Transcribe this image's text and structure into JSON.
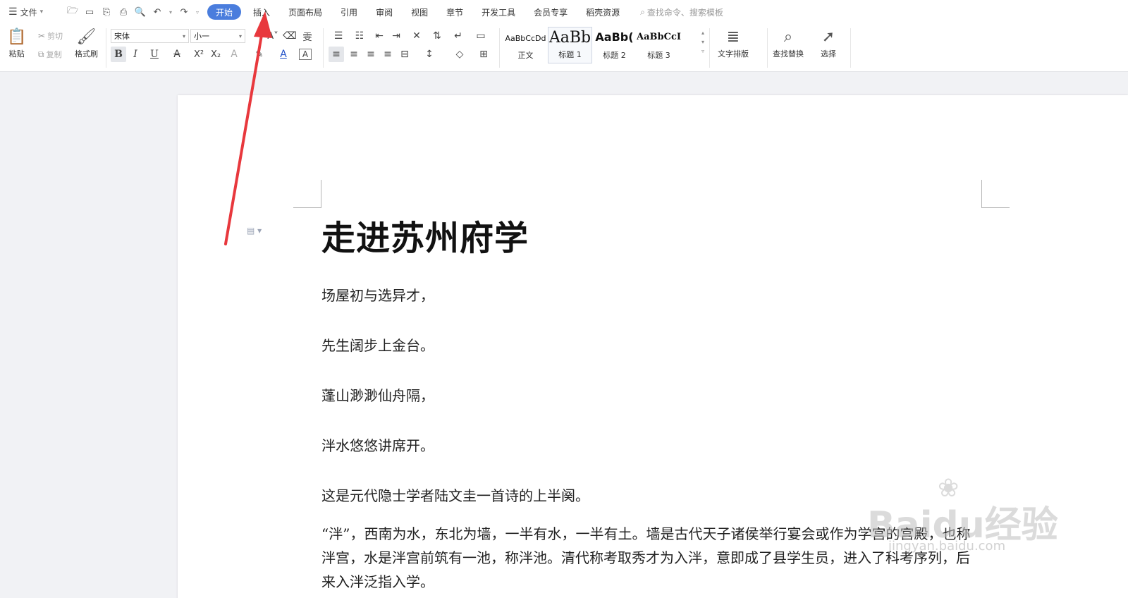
{
  "menubar": {
    "file_label": "文件",
    "tabs": [
      "开始",
      "插入",
      "页面布局",
      "引用",
      "审阅",
      "视图",
      "章节",
      "开发工具",
      "会员专享",
      "稻壳资源"
    ],
    "active_tab": "开始",
    "search_placeholder": "查找命令、搜索模板"
  },
  "ribbon": {
    "paste": "粘贴",
    "cut": "剪切",
    "copy": "复制",
    "format_painter": "格式刷",
    "font_name": "宋体",
    "font_size": "小一",
    "styles": [
      {
        "preview": "AaBbCcDd",
        "label": "正文"
      },
      {
        "preview": "AaBb",
        "label": "标题 1"
      },
      {
        "preview": "AaBb(",
        "label": "标题 2"
      },
      {
        "preview": "AaBbCcI",
        "label": "标题 3"
      }
    ],
    "text_layout": "文字排版",
    "find_replace": "查找替换",
    "select": "选择"
  },
  "document": {
    "title": "走进苏州府学",
    "lines": [
      "场屋初与选异才，",
      "先生阔步上金台。",
      "蓬山渺渺仙舟隔，",
      "泮水悠悠讲席开。",
      "这是元代隐士学者陆文圭一首诗的上半阕。"
    ],
    "paragraph": "“泮”，西南为水，东北为墙，一半有水，一半有土。墙是古代天子诸侯举行宴会或作为学宫的宫殿，也称泮宫，水是泮宫前筑有一池，称泮池。清代称考取秀才为入泮，意即成了县学生员，进入了科考序列，后来入泮泛指入学。"
  },
  "watermark": {
    "brand": "Baidu经验",
    "url": "jingyan.baidu.com"
  },
  "colors": {
    "active_tab": "#4a7ddd",
    "annotation_arrow": "#e8383d",
    "page_bg": "#ffffff",
    "canvas_bg": "#f1f2f5"
  }
}
